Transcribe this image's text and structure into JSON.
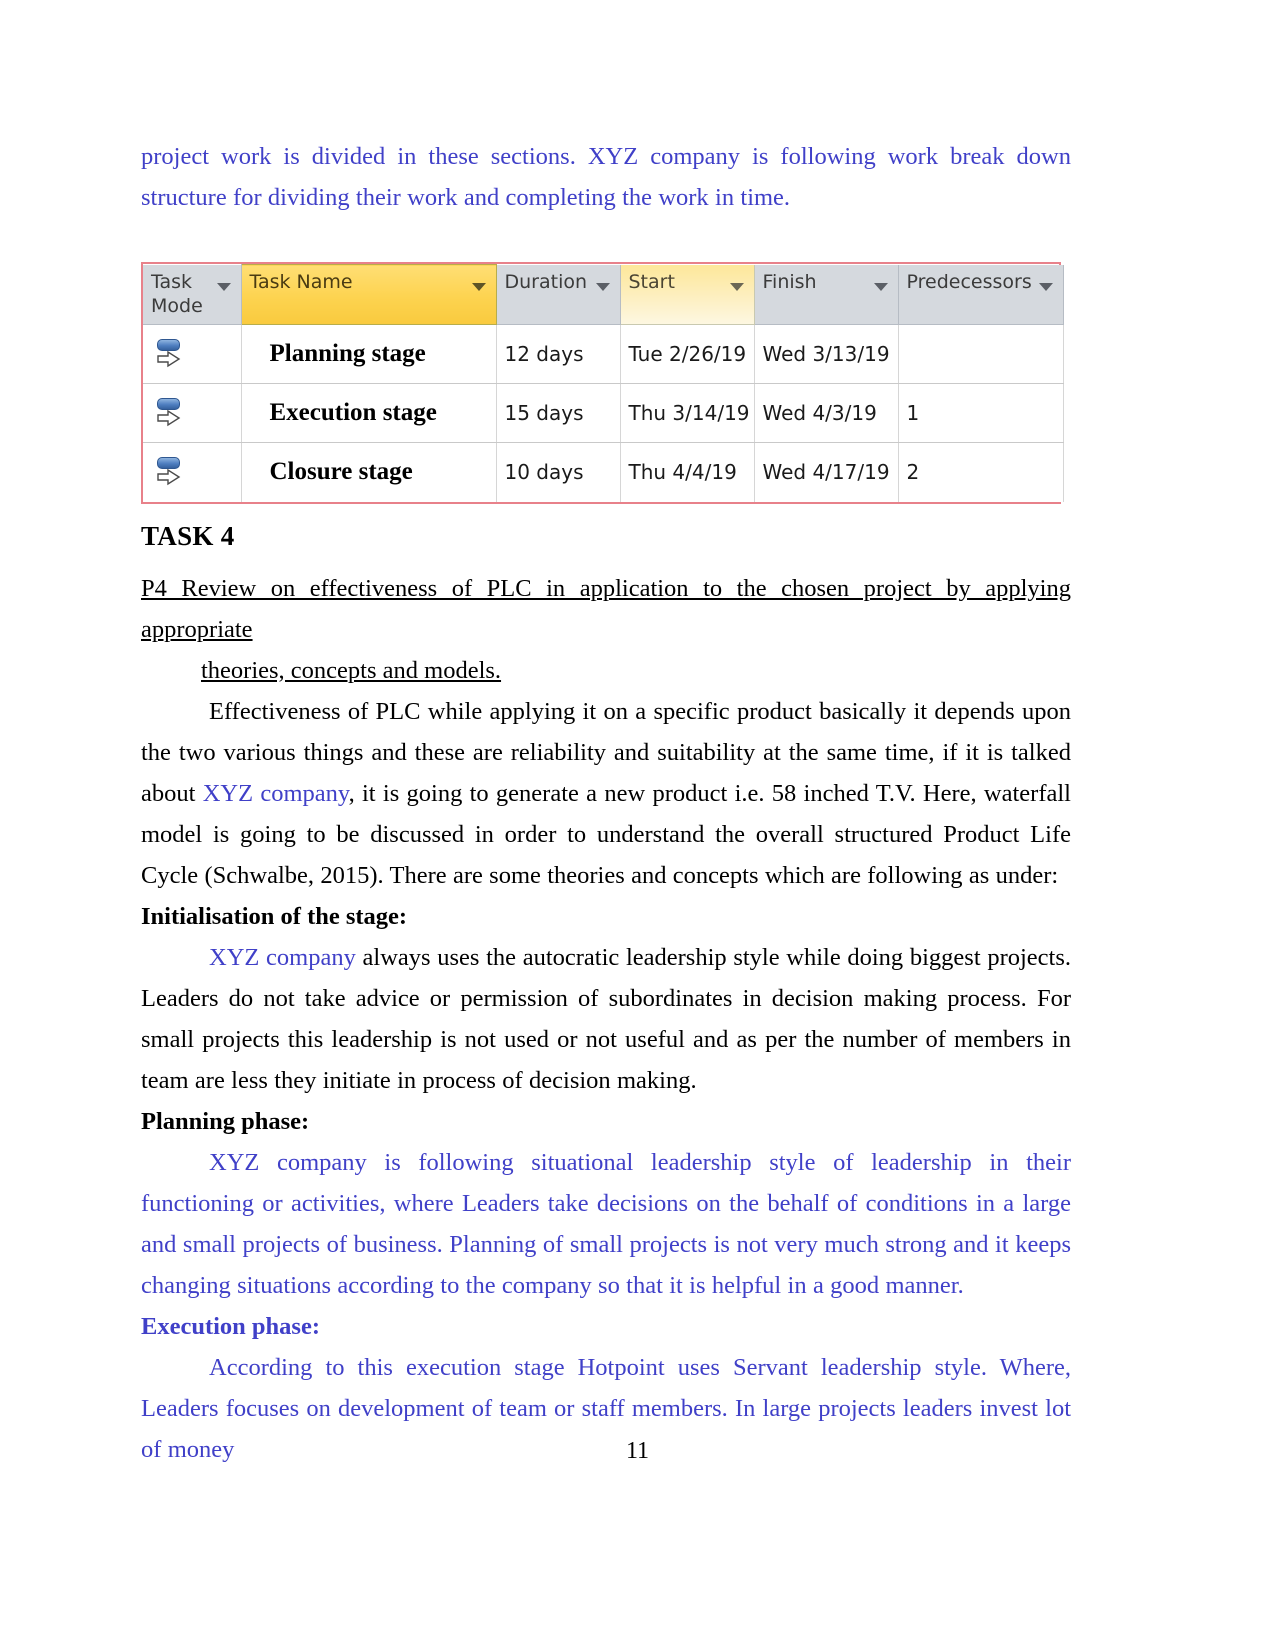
{
  "document": {
    "page_number": "11",
    "accent_blue": "#4040c8",
    "table_border_red": "#e8818a",
    "highlight_yellow": "#fdd34f"
  },
  "intro_paragraph": {
    "text": "project work is divided in these sections. XYZ company is following work break down structure for dividing their work and completing the work in time."
  },
  "project_table": {
    "columns": [
      {
        "key": "task_mode",
        "label": "Task Mode",
        "highlight": "none",
        "has_filter_arrow": true
      },
      {
        "key": "task_name",
        "label": "Task Name",
        "highlight": "strong",
        "has_filter_arrow": true
      },
      {
        "key": "duration",
        "label": "Duration",
        "highlight": "none",
        "has_filter_arrow": true
      },
      {
        "key": "start",
        "label": "Start",
        "highlight": "light",
        "has_filter_arrow": true
      },
      {
        "key": "finish",
        "label": "Finish",
        "highlight": "none",
        "has_filter_arrow": true
      },
      {
        "key": "predecessors",
        "label": "Predecessors",
        "highlight": "none",
        "has_filter_arrow": true
      }
    ],
    "rows": [
      {
        "task_mode_icon": "auto-scheduled-icon",
        "task_name": "Planning stage",
        "duration": "12 days",
        "start": "Tue 2/26/19",
        "finish": "Wed 3/13/19",
        "predecessors": ""
      },
      {
        "task_mode_icon": "auto-scheduled-icon",
        "task_name": "Execution stage",
        "duration": "15 days",
        "start": "Thu 3/14/19",
        "finish": "Wed 4/3/19",
        "predecessors": "1"
      },
      {
        "task_mode_icon": "auto-scheduled-icon",
        "task_name": "Closure stage",
        "duration": "10 days",
        "start": "Thu 4/4/19",
        "finish": "Wed 4/17/19",
        "predecessors": "2"
      }
    ]
  },
  "task_heading": "TASK 4",
  "p4_heading": {
    "line1": "P4 Review on effectiveness of PLC in application to the chosen project by applying appropriate",
    "line2": "theories, concepts and models."
  },
  "effectiveness_paragraph": {
    "part1": "Effectiveness of PLC while applying it on a specific product basically it depends upon the two various things and these are reliability and suitability at the same time, if it is talked about ",
    "highlight": "XYZ company",
    "part2": ", it is going to generate a new product i.e. 58 inched T.V. Here, waterfall model is going to be discussed in order to understand the overall structured Product Life Cycle (Schwalbe, 2015). There are some theories and concepts which are following as under:"
  },
  "initialisation": {
    "heading": "Initialisation of the stage:",
    "highlight": "XYZ company",
    "body": " always uses the autocratic leadership style while doing biggest projects. Leaders do not take advice or permission of subordinates in decision making process. For small projects this leadership is not used or not useful and as per the number of members in team are less they  initiate in process of decision making."
  },
  "planning_phase": {
    "heading": "Planning phase:",
    "body": "XYZ company is following situational leadership style of leadership in their functioning or activities, where Leaders take decisions on the behalf of conditions in a large and small projects of business. Planning of small projects is not very much strong and it keeps changing situations according to the company so that it is helpful in a good manner."
  },
  "execution_phase": {
    "heading": "Execution phase:",
    "body": "According to this execution stage Hotpoint uses Servant leadership style. Where, Leaders focuses on development of team or staff members. In large projects leaders invest lot of money"
  }
}
